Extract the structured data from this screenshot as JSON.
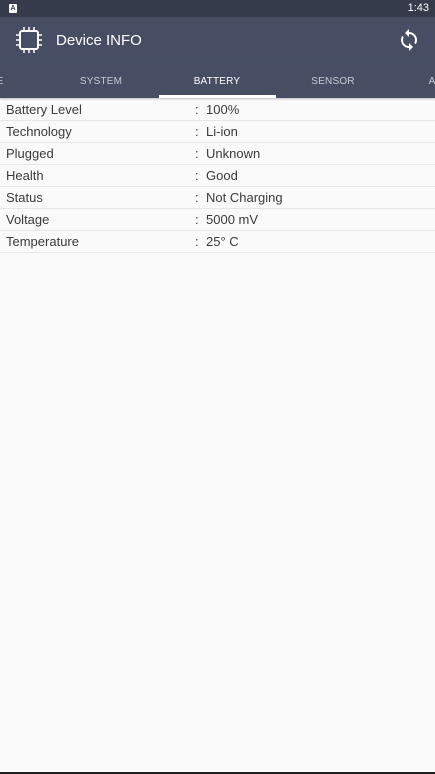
{
  "status_bar": {
    "notification_icon": "A",
    "time": "1:43"
  },
  "app_bar": {
    "icon": "cpu-chip-icon",
    "title": "Device INFO",
    "action_icon": "refresh-icon"
  },
  "tabs": [
    {
      "label": "E",
      "active": false
    },
    {
      "label": "SYSTEM",
      "active": false
    },
    {
      "label": "BATTERY",
      "active": true
    },
    {
      "label": "SENSOR",
      "active": false
    },
    {
      "label": "A",
      "active": false
    }
  ],
  "separator": ":",
  "battery": [
    {
      "label": "Battery Level",
      "value": "100%"
    },
    {
      "label": "Technology",
      "value": "Li-ion"
    },
    {
      "label": "Plugged",
      "value": "Unknown"
    },
    {
      "label": "Health",
      "value": "Good"
    },
    {
      "label": "Status",
      "value": "Not Charging"
    },
    {
      "label": "Voltage",
      "value": "5000 mV"
    },
    {
      "label": "Temperature",
      "value": "25° C"
    }
  ],
  "colors": {
    "status_bar": "#353b4b",
    "app_bar": "#474e63",
    "background": "#fafafa",
    "text": "#3a3a3a"
  }
}
